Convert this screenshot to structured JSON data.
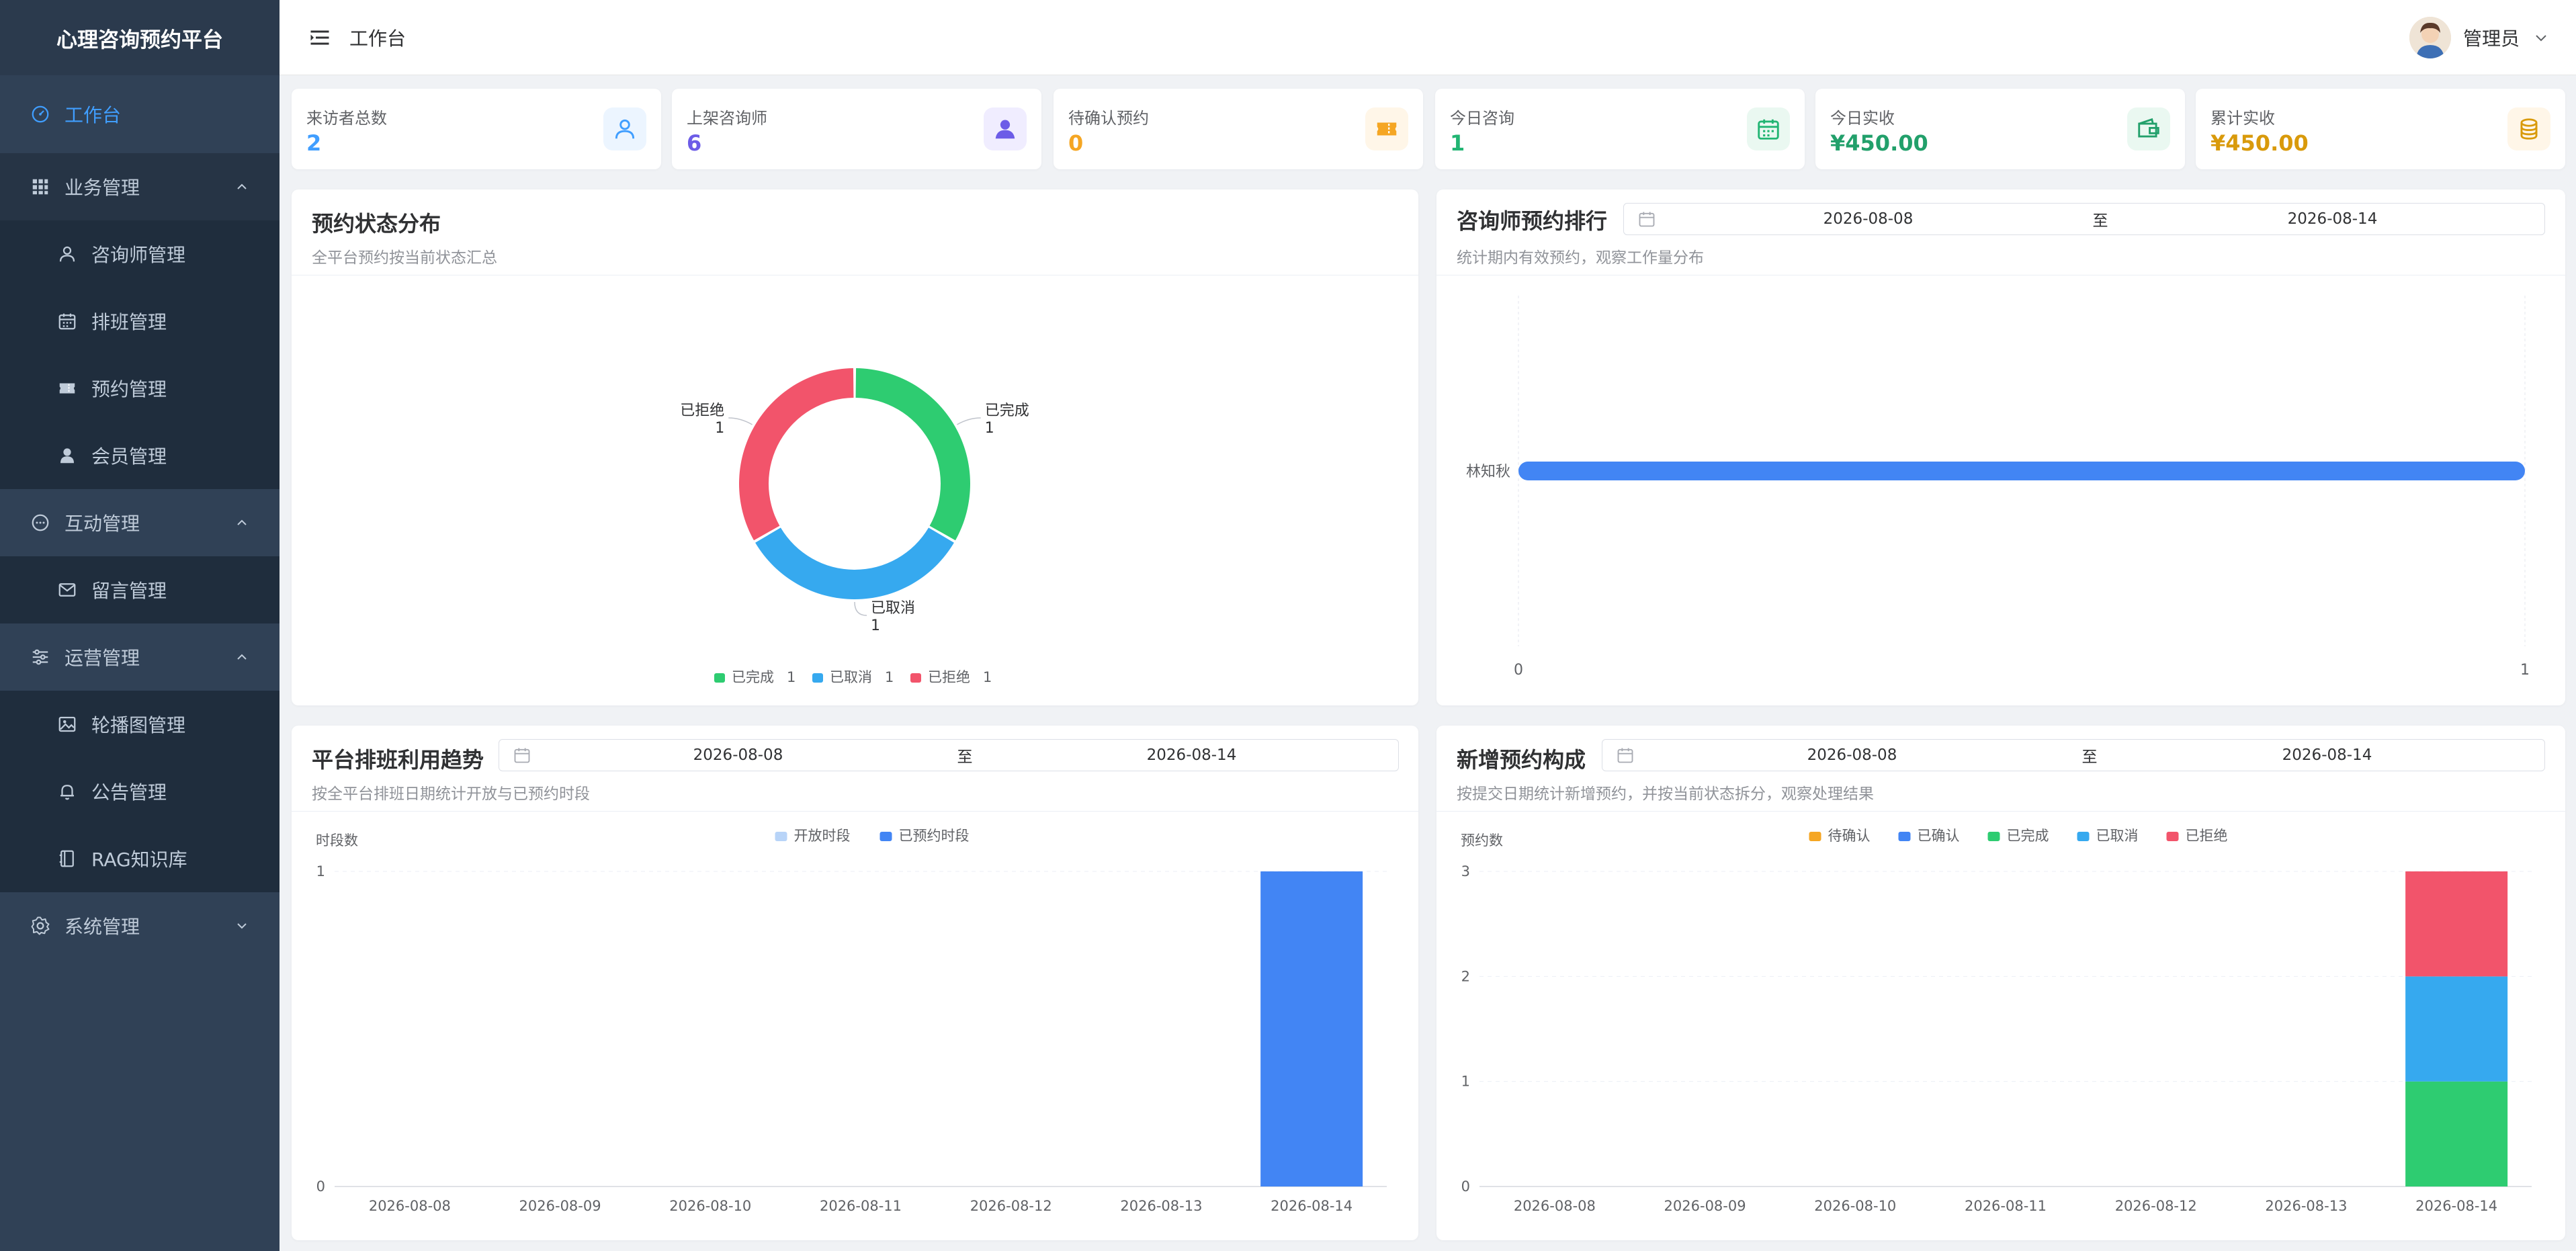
{
  "app": {
    "title": "心理咨询预约平台"
  },
  "sidebar": {
    "items": [
      {
        "label": "工作台",
        "icon": "dashboard-icon",
        "active": true
      },
      {
        "label": "业务管理",
        "icon": "grid-icon",
        "group": true,
        "expanded": true
      },
      {
        "label": "咨询师管理",
        "icon": "user-icon",
        "sub": true
      },
      {
        "label": "排班管理",
        "icon": "calendar-icon",
        "sub": true
      },
      {
        "label": "预约管理",
        "icon": "ticket-icon",
        "sub": true
      },
      {
        "label": "会员管理",
        "icon": "member-icon",
        "sub": true
      },
      {
        "label": "互动管理",
        "icon": "chat-icon",
        "group": true,
        "expanded": true
      },
      {
        "label": "留言管理",
        "icon": "mail-icon",
        "sub": true
      },
      {
        "label": "运营管理",
        "icon": "sliders-icon",
        "group": true,
        "expanded": true
      },
      {
        "label": "轮播图管理",
        "icon": "picture-icon",
        "sub": true
      },
      {
        "label": "公告管理",
        "icon": "bell-icon",
        "sub": true
      },
      {
        "label": "RAG知识库",
        "icon": "notebook-icon",
        "sub": true
      },
      {
        "label": "系统管理",
        "icon": "gear-icon",
        "group": true,
        "expanded": false
      }
    ]
  },
  "header": {
    "title": "工作台",
    "user_name": "管理员"
  },
  "stats": [
    {
      "label": "来访者总数",
      "value": "2",
      "color": "#409eff",
      "icon": "user-icon",
      "icon_bg": "#ecf5ff"
    },
    {
      "label": "上架咨询师",
      "value": "6",
      "color": "#6c5ce7",
      "icon": "person-icon",
      "icon_bg": "#f0edff"
    },
    {
      "label": "待确认预约",
      "value": "0",
      "color": "#f5a623",
      "icon": "ticket-icon",
      "icon_bg": "#fff6e8"
    },
    {
      "label": "今日咨询",
      "value": "1",
      "color": "#22b573",
      "icon": "calendar-icon",
      "icon_bg": "#eaf8f1"
    },
    {
      "label": "今日实收",
      "value": "¥450.00",
      "color": "#22a06b",
      "icon": "wallet-icon",
      "icon_bg": "#eaf8f1"
    },
    {
      "label": "累计实收",
      "value": "¥450.00",
      "color": "#d99a0b",
      "icon": "coins-icon",
      "icon_bg": "#fff6e8"
    }
  ],
  "panels": {
    "status": {
      "title": "预约状态分布",
      "subtitle": "全平台预约按当前状态汇总"
    },
    "ranking": {
      "title": "咨询师预约排行",
      "subtitle": "统计期内有效预约，观察工作量分布",
      "date_from": "2026-08-08",
      "date_to": "2026-08-14",
      "to_label": "至"
    },
    "schedule": {
      "title": "平台排班利用趋势",
      "subtitle": "按全平台排班日期统计开放与已预约时段",
      "date_from": "2026-08-08",
      "date_to": "2026-08-14",
      "to_label": "至"
    },
    "composition": {
      "title": "新增预约构成",
      "subtitle": "按提交日期统计新增预约，并按当前状态拆分，观察处理结果",
      "date_from": "2026-08-08",
      "date_to": "2026-08-14",
      "to_label": "至"
    }
  },
  "chart_data": [
    {
      "type": "pie",
      "donut": true,
      "labels": [
        "已完成",
        "已取消",
        "已拒绝"
      ],
      "values": [
        1,
        1,
        1
      ],
      "colors": [
        "#2ecc71",
        "#36a9ef",
        "#f2546b"
      ],
      "legend": "bottom"
    },
    {
      "type": "bar",
      "orientation": "horizontal",
      "categories": [
        "林知秋"
      ],
      "values": [
        1
      ],
      "xlim": [
        0,
        1
      ],
      "ticks": [
        "0",
        "1"
      ],
      "color": "#4285f4"
    },
    {
      "type": "bar",
      "ylabel": "时段数",
      "categories": [
        "2026-08-08",
        "2026-08-09",
        "2026-08-10",
        "2026-08-11",
        "2026-08-12",
        "2026-08-13",
        "2026-08-14"
      ],
      "series": [
        {
          "name": "开放时段",
          "color": "#b8d4f8",
          "values": [
            0,
            0,
            0,
            0,
            0,
            0,
            0
          ]
        },
        {
          "name": "已预约时段",
          "color": "#4285f4",
          "values": [
            0,
            0,
            0,
            0,
            0,
            0,
            1
          ]
        }
      ],
      "ylim": [
        0,
        1
      ],
      "yticks": [
        "0",
        "1"
      ],
      "legend": "top"
    },
    {
      "type": "bar",
      "stacked": true,
      "ylabel": "预约数",
      "categories": [
        "2026-08-08",
        "2026-08-09",
        "2026-08-10",
        "2026-08-11",
        "2026-08-12",
        "2026-08-13",
        "2026-08-14"
      ],
      "series": [
        {
          "name": "待确认",
          "color": "#f5a623",
          "values": [
            0,
            0,
            0,
            0,
            0,
            0,
            0
          ]
        },
        {
          "name": "已确认",
          "color": "#4285f4",
          "values": [
            0,
            0,
            0,
            0,
            0,
            0,
            0
          ]
        },
        {
          "name": "已完成",
          "color": "#2ecc71",
          "values": [
            0,
            0,
            0,
            0,
            0,
            0,
            1
          ]
        },
        {
          "name": "已取消",
          "color": "#36a9ef",
          "values": [
            0,
            0,
            0,
            0,
            0,
            0,
            1
          ]
        },
        {
          "name": "已拒绝",
          "color": "#f2546b",
          "values": [
            0,
            0,
            0,
            0,
            0,
            0,
            1
          ]
        }
      ],
      "ylim": [
        0,
        3
      ],
      "yticks": [
        "0",
        "1",
        "2",
        "3"
      ],
      "legend": "top"
    }
  ]
}
